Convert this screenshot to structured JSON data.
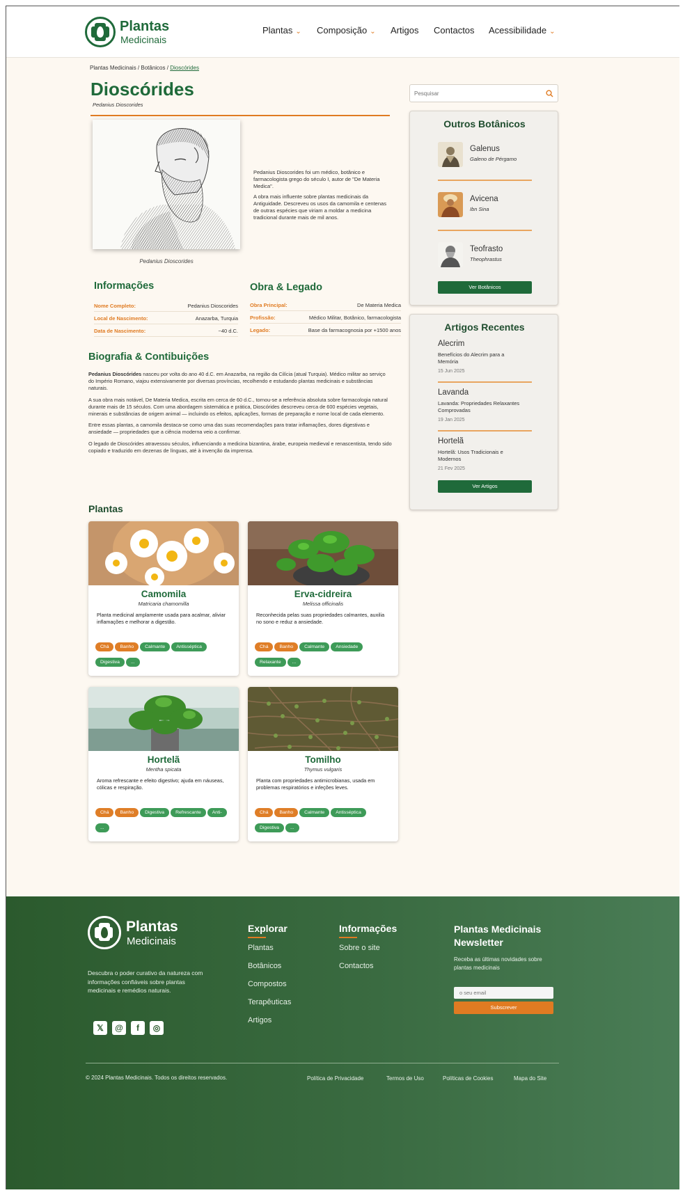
{
  "brand": {
    "name_line1": "Plantas",
    "name_line2": "Medicinais"
  },
  "nav": {
    "items": [
      {
        "label": "Plantas",
        "dropdown": true
      },
      {
        "label": "Composição",
        "dropdown": true
      },
      {
        "label": "Artigos",
        "dropdown": false
      },
      {
        "label": "Contactos",
        "dropdown": false
      },
      {
        "label": "Acessibilidade",
        "dropdown": true
      }
    ],
    "chevron": "⌄"
  },
  "breadcrumb": {
    "home": "Plantas Medicinais",
    "sep": " / ",
    "section": "Botânicos",
    "current": "Dioscórides"
  },
  "person": {
    "name": "Dioscórides",
    "latin_name": "Pedanius Dioscorides",
    "portrait_caption": "Pedanius Dioscorides",
    "intro": [
      "Pedanius Dioscorides foi um médico, botânico e farmacologista grego do século I, autor de \"De Materia Medica\".",
      "A obra mais influente sobre plantas medicinais da Antiguidade. Descreveu os usos da camomila e centenas de outras espécies que viriam a moldar a medicina tradicional durante mais de mil anos."
    ]
  },
  "info": {
    "heading": "Informações",
    "rows": [
      {
        "key": "Nome Completo:",
        "value": "Pedanius Dioscorides"
      },
      {
        "key": "Local de Nascimento:",
        "value": "Anazarba, Turquia"
      },
      {
        "key": "Data de Nascimento:",
        "value": "~40 d.C."
      }
    ]
  },
  "legacy": {
    "heading": "Obra & Legado",
    "rows": [
      {
        "key": "Obra Principal:",
        "value": "De Materia Medica"
      },
      {
        "key": "Profissão:",
        "value": "Médico Militar, Botânico, farmacologista"
      },
      {
        "key": "Legado:",
        "value": "Base da farmacognosia por +1500 anos"
      }
    ]
  },
  "biography": {
    "heading": "Biografia & Contibuições",
    "p1_bold": "Pedanius Dioscórides",
    "p1_rest": " nasceu por volta do ano 40 d.C. em Anazarba, na região da Cilícia (atual Turquia). Médico militar ao serviço do Império Romano, viajou extensivamente por diversas províncias, recolhendo e estudando plantas medicinais e substâncias naturais.",
    "p2": "A sua obra mais notável, De Materia Medica, escrita em cerca de 60 d.C., tornou-se a referência absoluta sobre farmacologia natural durante mais de 15 séculos. Com uma abordagem sistemática e prática, Dioscórides descreveu cerca de 600 espécies vegetais, minerais e substâncias de origem animal — incluindo os efeitos, aplicações, formas de preparação e nome local de cada elemento.",
    "p3": "Entre essas plantas, a camomila destaca-se como uma das suas recomendações para tratar inflamações, dores digestivas e ansiedade — propriedades que a ciência moderna veio a confirmar.",
    "p4": "O legado de Dioscórides atravessou séculos, influenciando a medicina bizantina, árabe, europeia medieval e renascentista, tendo sido copiado e traduzido em dezenas de línguas, até à invenção da imprensa."
  },
  "search": {
    "placeholder": "Pesquisar"
  },
  "other_botanists": {
    "heading": "Outros Botânicos",
    "items": [
      {
        "name": "Galenus",
        "sub": "Galeno de Pérgamo"
      },
      {
        "name": "Avicena",
        "sub": "Ibn Sina"
      },
      {
        "name": "Teofrasto",
        "sub": "Theophrastus"
      }
    ],
    "button": "Ver Botânicos"
  },
  "recent_articles": {
    "heading": "Artigos Recentes",
    "items": [
      {
        "title": "Alecrim",
        "desc": "Benefícios do Alecrim para a Memória",
        "date": "15 Jun 2025"
      },
      {
        "title": "Lavanda",
        "desc": "Lavanda: Propriedades Relaxantes Comprovadas",
        "date": "19 Jan 2025"
      },
      {
        "title": "Hortelã",
        "desc": "Hortelã: Usos Tradicionais e Modernos",
        "date": "21 Fev 2025"
      }
    ],
    "button": "Ver Artigos"
  },
  "plants": {
    "heading": "Plantas",
    "cards": [
      {
        "name": "Camomila",
        "sci": "Matricaria chamomilla",
        "desc": "Planta medicinal amplamente usada para acalmar, aliviar inflamações e melhorar a digestão.",
        "tags": [
          {
            "t": "Chá",
            "c": "o"
          },
          {
            "t": "Banho",
            "c": "o"
          },
          {
            "t": "Calmante",
            "c": "g"
          },
          {
            "t": "Antisséptica",
            "c": "g"
          },
          {
            "t": "Digestiva",
            "c": "g"
          },
          {
            "t": "...",
            "c": "g"
          }
        ]
      },
      {
        "name": "Erva-cidreira",
        "sci": "Melissa officinalis",
        "desc": "Reconhecida pelas suas propriedades calmantes, auxilia no sono e reduz a ansiedade.",
        "tags": [
          {
            "t": "Chá",
            "c": "o"
          },
          {
            "t": "Banho",
            "c": "o"
          },
          {
            "t": "Calmante",
            "c": "g"
          },
          {
            "t": "Ansiedade",
            "c": "g"
          },
          {
            "t": "Relaxante",
            "c": "g"
          },
          {
            "t": "...",
            "c": "g"
          }
        ]
      },
      {
        "name": "Hortelã",
        "sci": "Mentha spicata",
        "desc": "Aroma refrescante e efeito digestivo; ajuda em náuseas, cólicas e respiração.",
        "tags": [
          {
            "t": "Chá",
            "c": "o"
          },
          {
            "t": "Banho",
            "c": "o"
          },
          {
            "t": "Digestiva",
            "c": "g"
          },
          {
            "t": "Refrescante",
            "c": "g"
          },
          {
            "t": "Anti-",
            "c": "g"
          },
          {
            "t": "...",
            "c": "g"
          }
        ]
      },
      {
        "name": "Tomilho",
        "sci": "Thymus vulgaris",
        "desc": "Planta com propriedades antimicrobianas, usada em problemas respiratórios e infeções leves.",
        "tags": [
          {
            "t": "Chá",
            "c": "o"
          },
          {
            "t": "Banho",
            "c": "o"
          },
          {
            "t": "Calmante",
            "c": "g"
          },
          {
            "t": "Antisséptica",
            "c": "g"
          },
          {
            "t": "Digestiva",
            "c": "g"
          },
          {
            "t": "...",
            "c": "g"
          }
        ]
      }
    ]
  },
  "footer": {
    "tagline": "Descubra o poder curativo da natureza com informações confiáveis sobre plantas medicinais e remédios naturais.",
    "explore": {
      "heading": "Explorar",
      "links": [
        "Plantas",
        "Botânicos",
        "Compostos",
        "Terapêuticas",
        "Artigos"
      ]
    },
    "info": {
      "heading": "Informações",
      "links": [
        "Sobre o site",
        "Contactos"
      ]
    },
    "newsletter": {
      "heading_line1": "Plantas Medicinais",
      "heading_line2": "Newsletter",
      "text": "Receba as últimas novidades sobre plantas medicinais",
      "placeholder": "o seu email",
      "button": "Subscrever"
    },
    "social": [
      {
        "icon": "x-icon",
        "glyph": "𝕏"
      },
      {
        "icon": "threads-icon",
        "glyph": "@"
      },
      {
        "icon": "facebook-icon",
        "glyph": "f"
      },
      {
        "icon": "instagram-icon",
        "glyph": "◎"
      }
    ],
    "copyright": "© 2024 Plantas Medicinais. Todos os direitos reservados.",
    "legal": [
      "Política de Privacidade",
      "Termos de Uso",
      "Políticas de Cookies",
      "Mapa do Site"
    ]
  },
  "colors": {
    "brand_green": "#1f6a3a",
    "accent_orange": "#e07b22",
    "footer_green": "#2b5a2d",
    "page_bg": "#fdf8f1"
  }
}
